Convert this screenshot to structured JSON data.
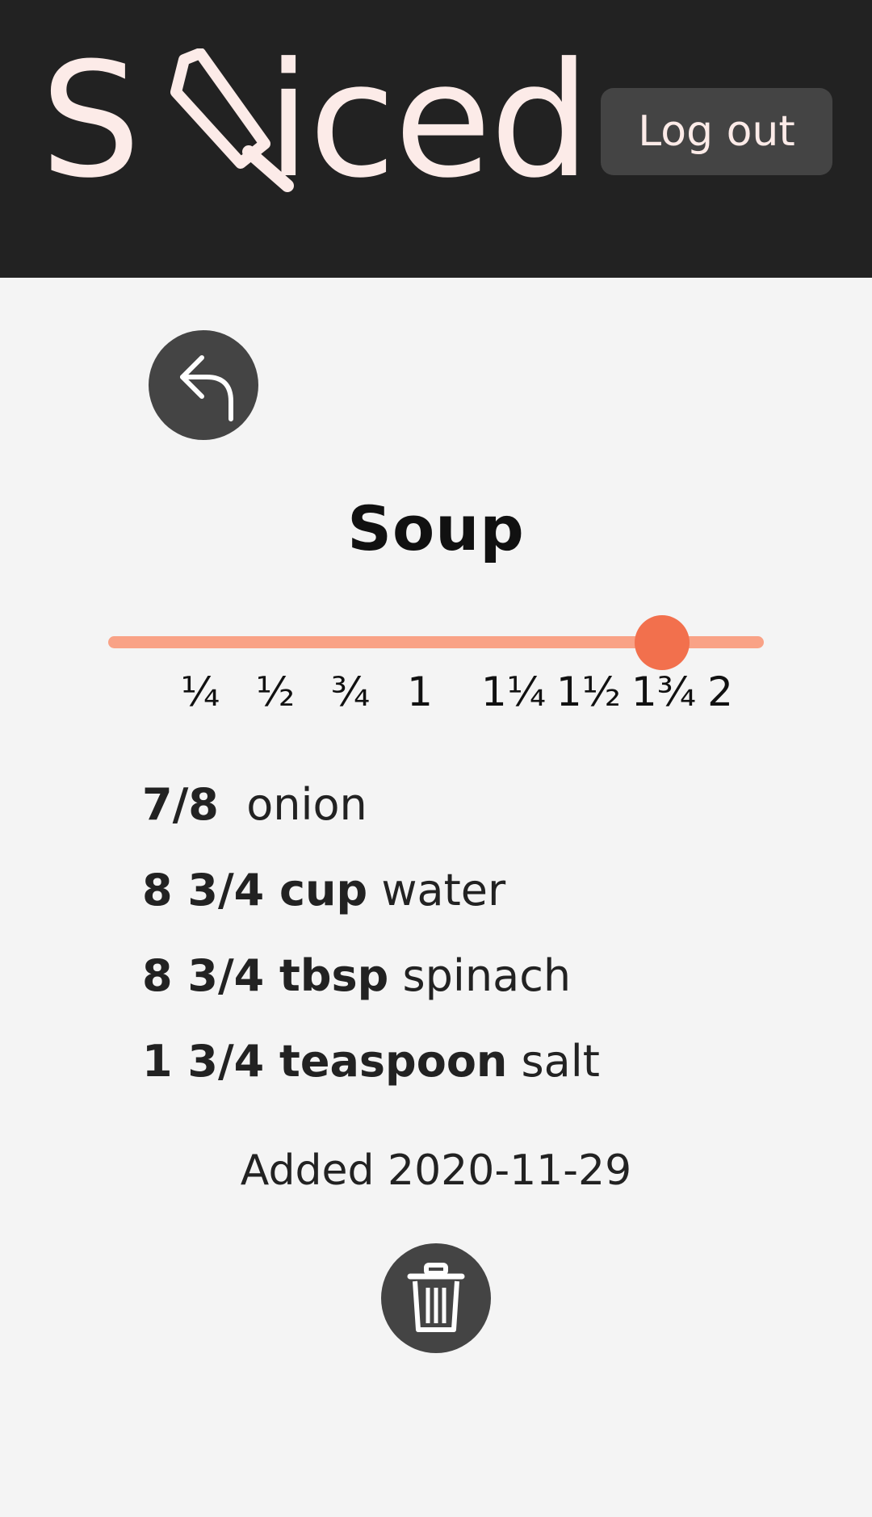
{
  "header": {
    "logo": {
      "text": "Sliced",
      "first_letter": "S",
      "rest": "iced",
      "icon": "knife-icon",
      "color": "#fcebe8"
    },
    "logout_label": "Log out",
    "background": "#222222"
  },
  "back": {
    "icon": "back-arrow-icon"
  },
  "recipe": {
    "title": "Soup",
    "scale": {
      "labels": [
        "¼",
        "½",
        "¾",
        "1",
        "1¼",
        "1½",
        "1¾",
        "2"
      ],
      "selected": "1¾",
      "track_color": "#f9a286",
      "thumb_color": "#f2704d"
    },
    "ingredients": [
      {
        "qty": "7/8",
        "name": "onion"
      },
      {
        "qty": "8 3/4 cup",
        "name": "water"
      },
      {
        "qty": "8 3/4 tbsp",
        "name": "spinach"
      },
      {
        "qty": "1 3/4 teaspoon",
        "name": "salt"
      }
    ],
    "added": "Added 2020-11-29"
  },
  "delete": {
    "icon": "trash-icon"
  }
}
